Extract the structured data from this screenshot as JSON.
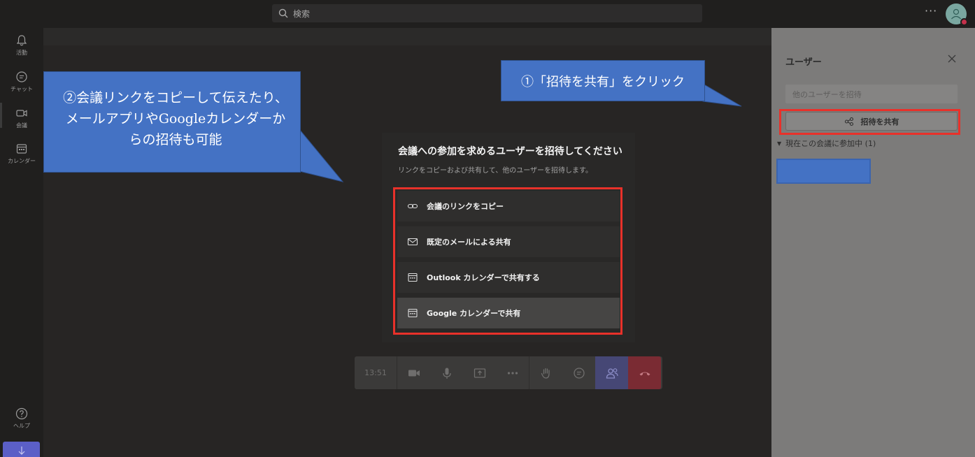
{
  "header": {
    "search_placeholder": "検索",
    "more": "···"
  },
  "rail": {
    "items": [
      {
        "label": "活動",
        "icon": "bell-icon"
      },
      {
        "label": "チャット",
        "icon": "chat-icon"
      },
      {
        "label": "会議",
        "icon": "video-icon"
      },
      {
        "label": "カレンダー",
        "icon": "calendar-icon"
      }
    ],
    "help": "ヘルプ"
  },
  "panel": {
    "title": "ユーザー",
    "invite_placeholder": "他のユーザーを招待",
    "share_label": "招待を共有",
    "in_meeting": "現在この会議に参加中 (1)"
  },
  "modal": {
    "title": "会議への参加を求めるユーザーを招待してください",
    "subtitle": "リンクをコピーおよび共有して、他のユーザーを招待します。",
    "options": [
      {
        "label": "会議のリンクをコピー",
        "icon": "link-icon"
      },
      {
        "label": "既定のメールによる共有",
        "icon": "mail-icon"
      },
      {
        "label": "Outlook カレンダーで共有する",
        "icon": "calendar-icon"
      },
      {
        "label": "Google カレンダーで共有",
        "icon": "calendar-icon"
      }
    ]
  },
  "controls": {
    "time": "13:51"
  },
  "callouts": {
    "step1": "①「招待を共有」をクリック",
    "step2": "②会議リンクをコピーして伝えたり、メールアプリやGoogleカレンダーからの招待も可能"
  },
  "colors": {
    "callout": "#4472c4",
    "highlight": "#e8312a",
    "accent": "#5b5fc7"
  }
}
